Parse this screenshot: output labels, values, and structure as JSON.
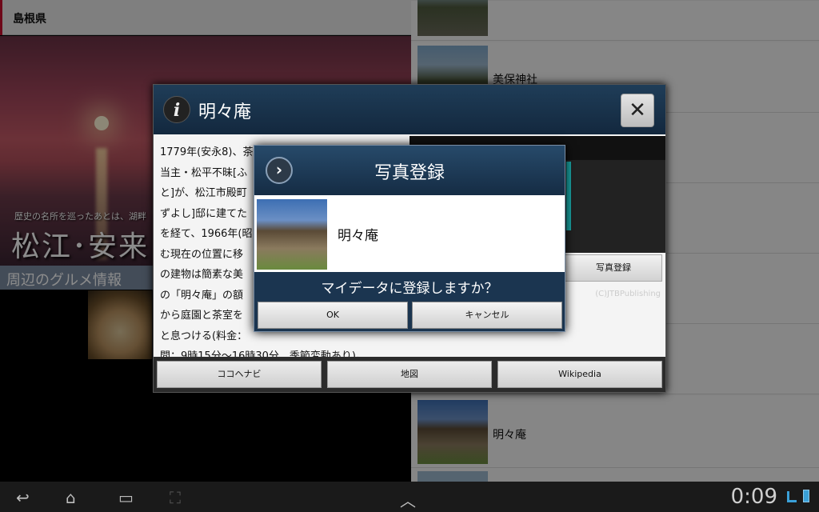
{
  "app": {
    "title": "島根県"
  },
  "left_panel": {
    "caption": "歴史の名所を巡ったあとは、湖畔",
    "big_text": "松江･安来･安",
    "gourmet_label": "周辺のグルメ情報"
  },
  "list": {
    "items": [
      {
        "label": "美保神社"
      },
      {
        "label": "明々庵"
      }
    ]
  },
  "info_dialog": {
    "title": "明々庵",
    "close_label": "✕",
    "body_lines": [
      "1779年(安永8)、茶",
      "当主・松平不昧[ふ",
      "と]が、松江市殿町",
      "ずよし]邸に建てた",
      "を経て、1966年(昭",
      "む現在の位置に移",
      "の建物は簡素な美",
      "の「明々庵」の額",
      "から庭園と茶室を",
      "と息つける(料金：",
      "間：9時15分～16時30分、季節変動あり)。"
    ],
    "credit": "(C)JTBPublishing",
    "photo_register_button": "写真登録",
    "bottom_buttons": [
      "ココヘナビ",
      "地図",
      "Wikipedia"
    ]
  },
  "register_dialog": {
    "title": "写真登録",
    "item_name": "明々庵",
    "question": "マイデータに登録しますか？",
    "ok_label": "OK",
    "cancel_label": "キャンセル"
  },
  "system_bar": {
    "clock": "0:09"
  }
}
